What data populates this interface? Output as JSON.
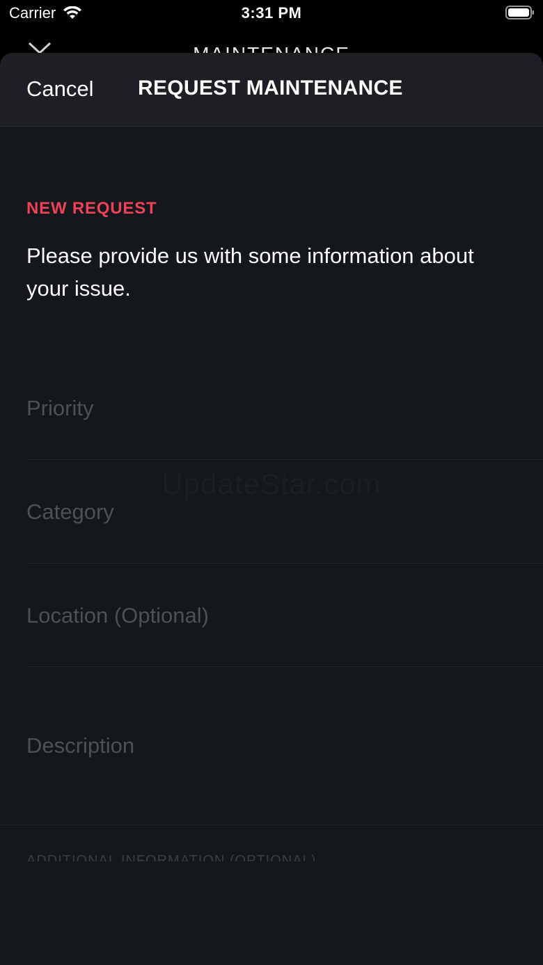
{
  "status_bar": {
    "carrier": "Carrier",
    "time": "3:31 PM"
  },
  "background_screen": {
    "title": "MAINTENANCE"
  },
  "nav": {
    "cancel_label": "Cancel",
    "title": "REQUEST MAINTENANCE"
  },
  "form": {
    "section_label": "NEW REQUEST",
    "intro": "Please provide us with some information about your issue.",
    "fields": {
      "priority": "Priority",
      "category": "Category",
      "location": "Location (Optional)",
      "description": "Description"
    },
    "additional_label": "ADDITIONAL INFORMATION (OPTIONAL)"
  },
  "watermark": "UpdateStar.com",
  "colors": {
    "accent": "#ef4257",
    "sheet_background": "#14171b",
    "placeholder": "#4c5157"
  }
}
